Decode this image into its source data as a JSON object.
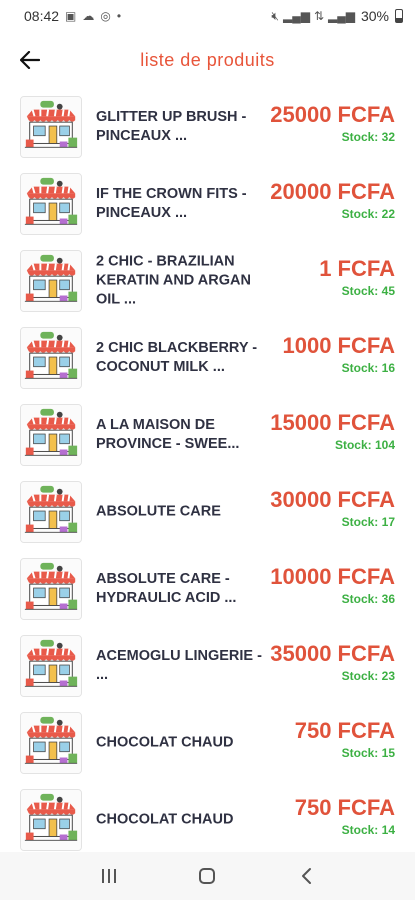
{
  "status_bar": {
    "time": "08:42",
    "notification_icons": [
      "image-icon",
      "cloud-icon",
      "whatsapp-icon",
      "dot-icon"
    ],
    "system_icons": [
      "mute-icon",
      "signal-icon",
      "data-icon",
      "signal-icon-2"
    ],
    "battery": "30%"
  },
  "header": {
    "title": "liste de produits",
    "back_icon": "arrow-left-icon"
  },
  "stock_label": "Stock:",
  "products": [
    {
      "name": " GLITTER UP BRUSH - PINCEAUX ...",
      "price": "25000 FCFA",
      "stock": "32"
    },
    {
      "name": " IF THE CROWN FITS - PINCEAUX ...",
      "price": "20000 FCFA",
      "stock": "22"
    },
    {
      "name": "2 CHIC - BRAZILIAN KERATIN AND ARGAN OIL ...",
      "price": "1 FCFA",
      "stock": "45"
    },
    {
      "name": "2 CHIC BLACKBERRY - COCONUT MILK ...",
      "price": "1000 FCFA",
      "stock": "16"
    },
    {
      "name": "A LA MAISON DE PROVINCE - SWEE...",
      "price": "15000 FCFA",
      "stock": "104"
    },
    {
      "name": "ABSOLUTE CARE",
      "price": "30000 FCFA",
      "stock": "17"
    },
    {
      "name": "ABSOLUTE CARE - HYDRAULIC ACID ...",
      "price": "10000 FCFA",
      "stock": "36"
    },
    {
      "name": "ACEMOGLU LINGERIE - ...",
      "price": "35000 FCFA",
      "stock": "23"
    },
    {
      "name": "CHOCOLAT CHAUD",
      "price": "750 FCFA",
      "stock": "15"
    },
    {
      "name": "CHOCOLAT CHAUD",
      "price": "750 FCFA",
      "stock": "14"
    }
  ],
  "nav_bar": {
    "icons": [
      "recents-icon",
      "home-icon",
      "back-icon"
    ]
  },
  "colors": {
    "accent": "#e8553a",
    "price": "#e0533b",
    "stock": "#3cb043",
    "name": "#2f3142"
  }
}
